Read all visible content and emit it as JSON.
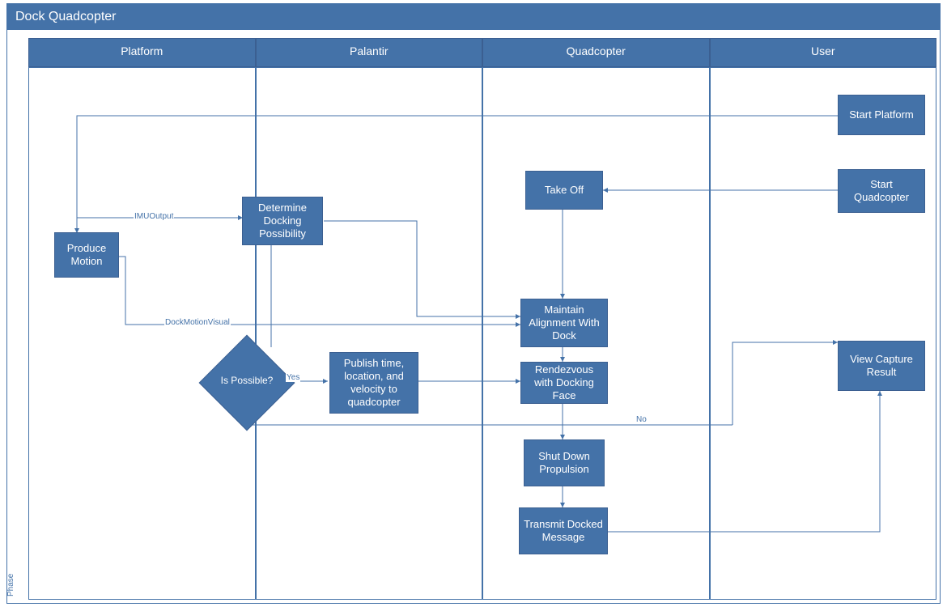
{
  "title": "Dock Quadcopter",
  "phase_label": "Phase",
  "lanes": [
    "Platform",
    "Palantir",
    "Quadcopter",
    "User"
  ],
  "nodes": {
    "produce_motion": "Produce Motion",
    "determine_docking": "Determine Docking Possibility",
    "is_possible": "Is Possible?",
    "publish": "Publish time, location, and velocity to quadcopter",
    "take_off": "Take Off",
    "maintain_alignment": "Maintain Alignment With Dock",
    "rendezvous": "Rendezvous with Docking Face",
    "shut_down": "Shut Down Propulsion",
    "transmit": "Transmit Docked Message",
    "start_platform": "Start Platform",
    "start_quadcopter": "Start Quadcopter",
    "view_result": "View Capture Result"
  },
  "edge_labels": {
    "imu_output": "IMUOutput",
    "dock_motion_visual": "DockMotionVisual",
    "yes": "Yes",
    "no": "No"
  }
}
